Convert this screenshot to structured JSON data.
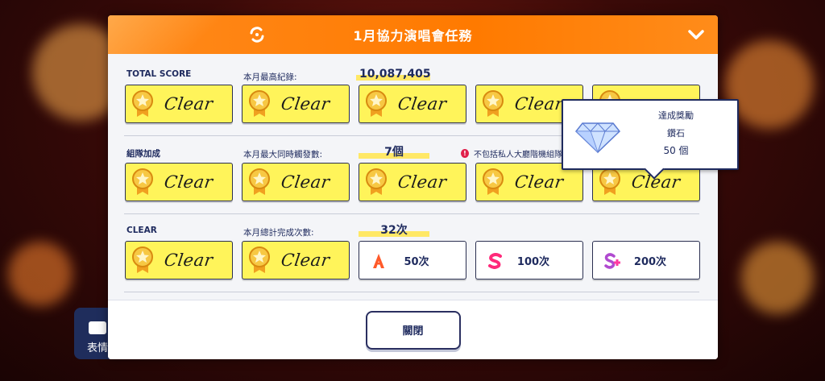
{
  "header": {
    "title": "1月協力演唱會任務"
  },
  "rows": {
    "total_score": {
      "label": "TOTAL SCORE",
      "meta_label": "本月最高紀錄:",
      "meta_value": "10,087,405",
      "tiles": [
        "Clear",
        "Clear",
        "Clear",
        "Clear"
      ]
    },
    "team": {
      "label": "組隊加成",
      "meta_label": "本月最大同時觸發數:",
      "meta_value": "7個",
      "note": "不包括私人大廳階機組隊",
      "tiles": [
        "Clear",
        "Clear",
        "Clear",
        "Clear",
        "Clear"
      ]
    },
    "clear": {
      "label": "CLEAR",
      "meta_label": "本月總計完成次數:",
      "meta_value": "32次",
      "tiles": [
        "Clear",
        "Clear"
      ],
      "ranks": [
        {
          "rank": "A",
          "label": "50次",
          "color": "#ff5a2a"
        },
        {
          "rank": "S",
          "label": "100次",
          "color": "#ff2a7a"
        },
        {
          "rank": "S+",
          "label": "200次",
          "color": "#ff3aa0"
        }
      ]
    }
  },
  "tooltip": {
    "title": "達成獎勵",
    "item": "鑽石",
    "amount": "50 個"
  },
  "footer": {
    "close_label": "關閉"
  },
  "side_button": {
    "label": "表情"
  },
  "colors": {
    "orange": "#ff7a00",
    "yellow": "#fff45a",
    "navy": "#1e2a5e"
  }
}
